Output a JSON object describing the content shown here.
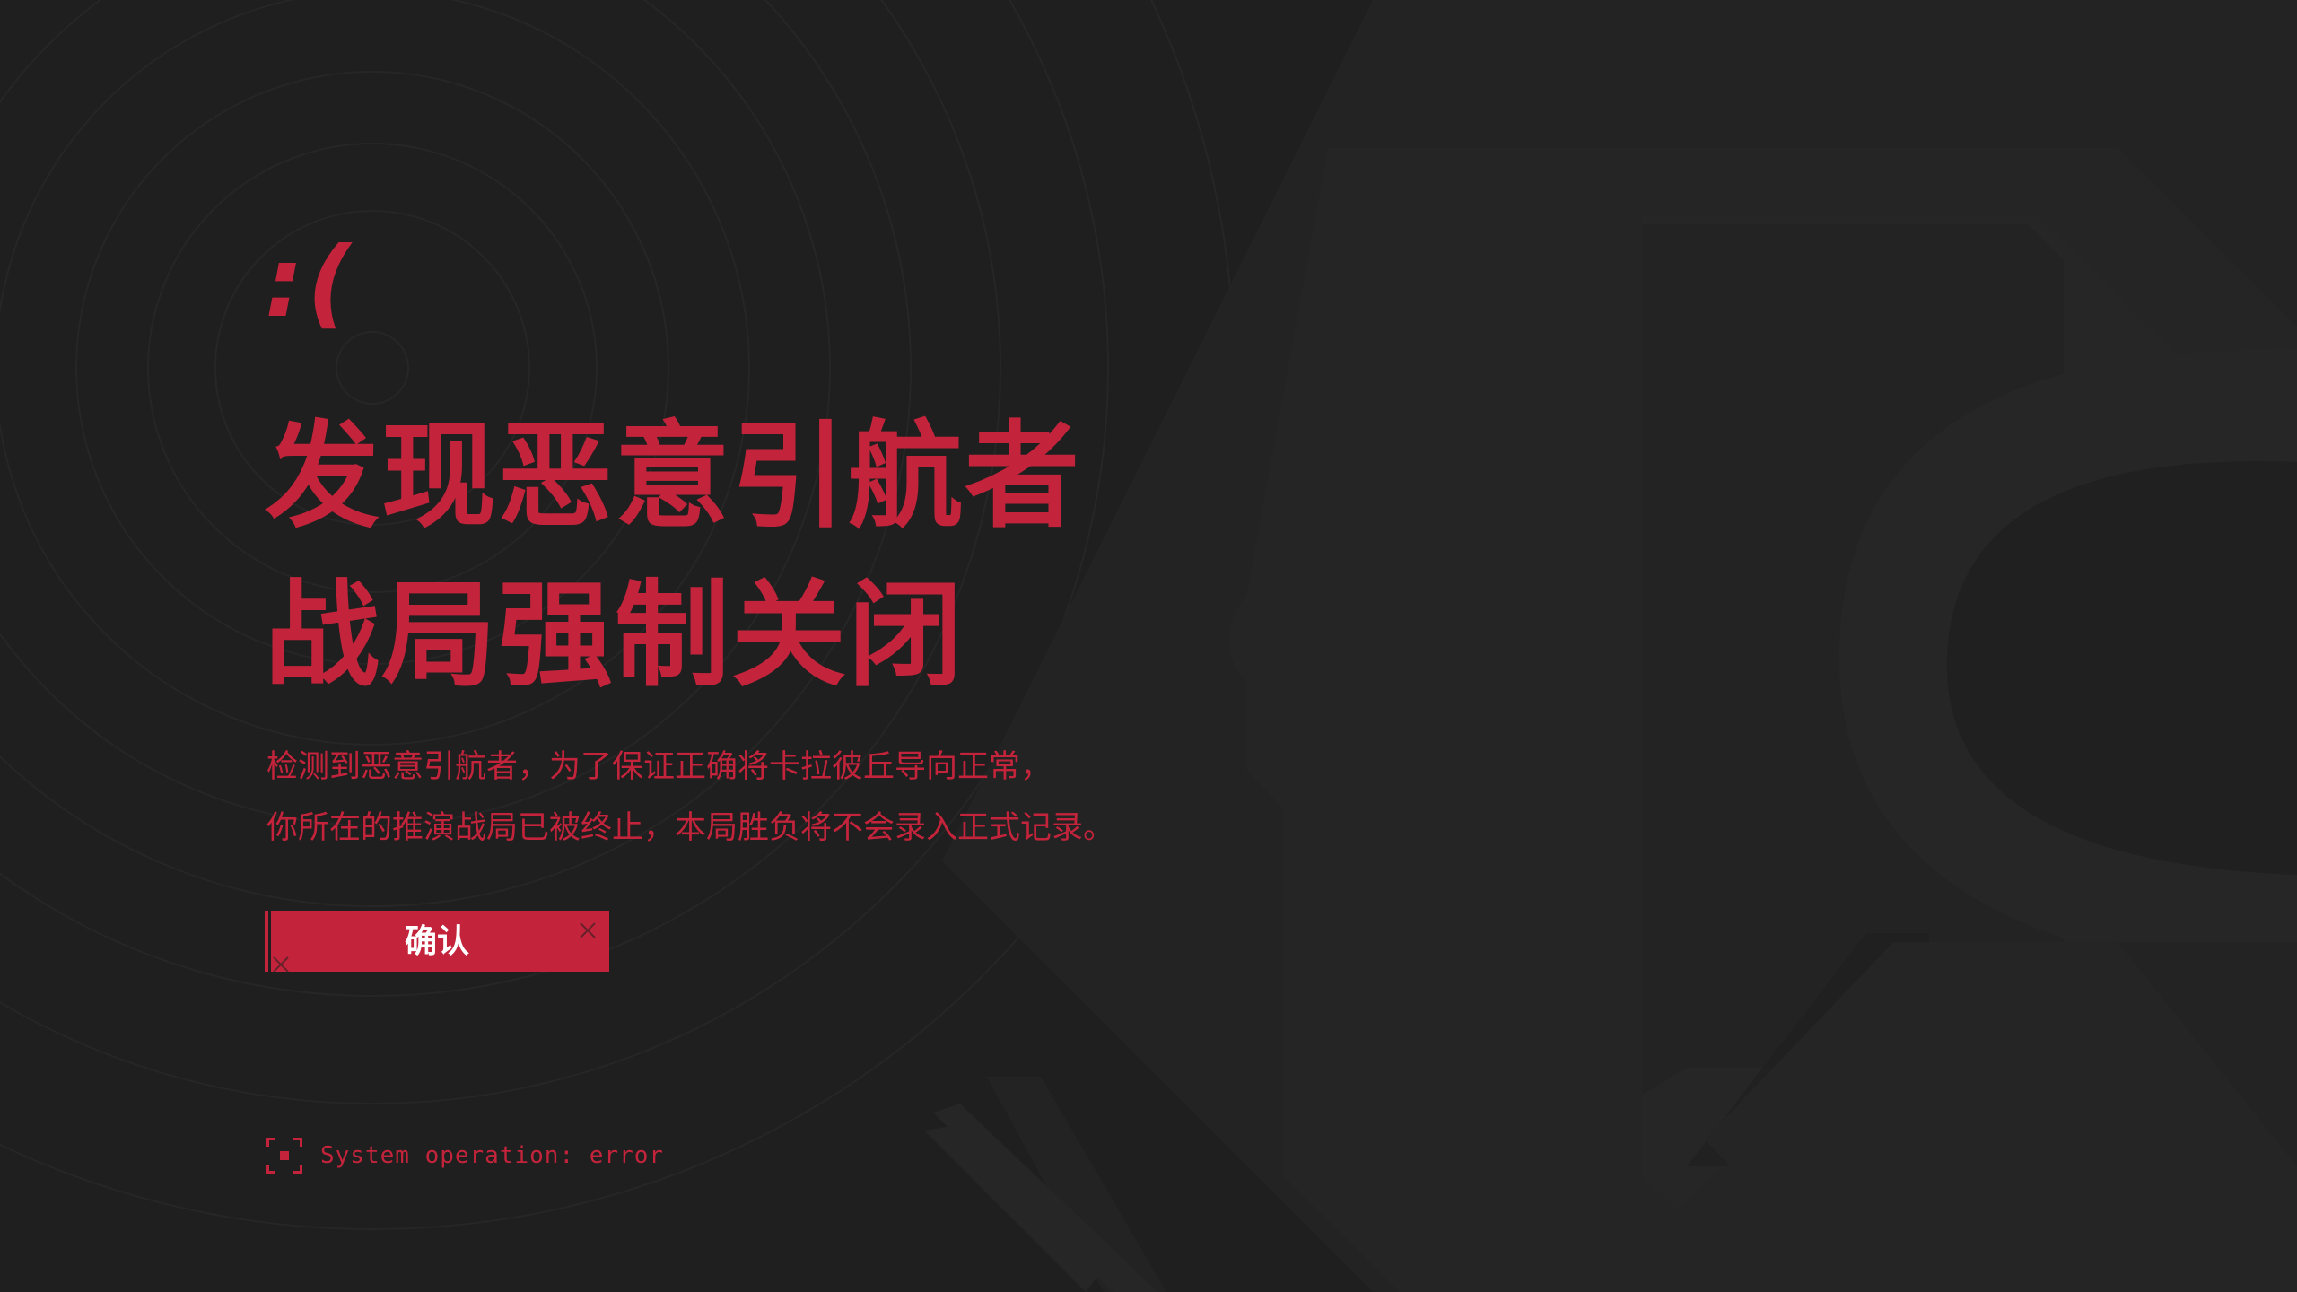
{
  "colors": {
    "accent": "#c3243b",
    "background": "#1f1f1f",
    "button_text": "#ffffff"
  },
  "error": {
    "emoticon": ":(",
    "headline_line1": "发现恶意引航者",
    "headline_line2": "战局强制关闭",
    "description_line1": "检测到恶意引航者，为了保证正确将卡拉彼丘导向正常，",
    "description_line2": "你所在的推演战局已被终止，本局胜负将不会录入正式记录。"
  },
  "actions": {
    "confirm_label": "确认"
  },
  "status": {
    "icon": "focus-frame-icon",
    "text": "System operation: error"
  }
}
